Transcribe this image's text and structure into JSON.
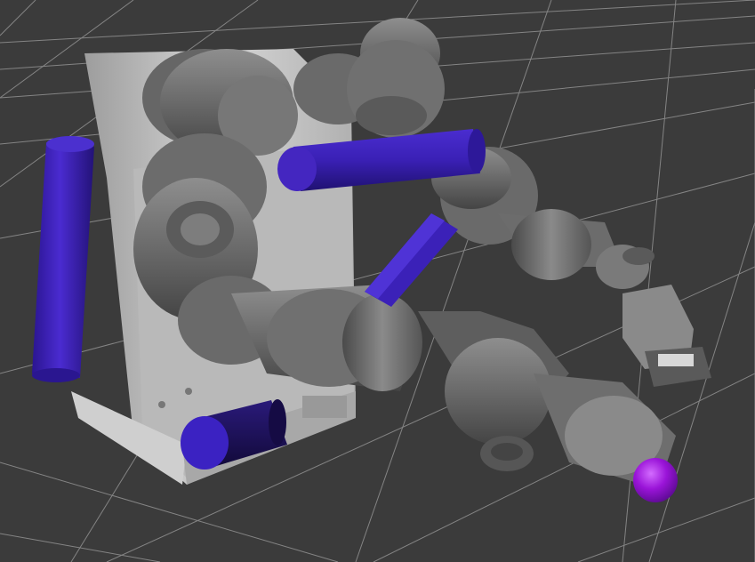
{
  "viewport": {
    "background_color": "#3b3b3b",
    "grid_color": "#8c8c8c",
    "grid_visible": true
  },
  "robot": {
    "body_color": "#6f6f6f",
    "highlight_color": "#9a9a9a",
    "shadow_color": "#3f3f3f",
    "base_color": "#c8c8c8"
  },
  "collision_objects": {
    "cylinder_color": "#3c1fb0",
    "cylinder_dark_color": "#1f1266",
    "sphere_color": "#9a14d8"
  },
  "icons": [
    "grid-floor-icon",
    "robot-arm-icon",
    "gripper-icon"
  ]
}
